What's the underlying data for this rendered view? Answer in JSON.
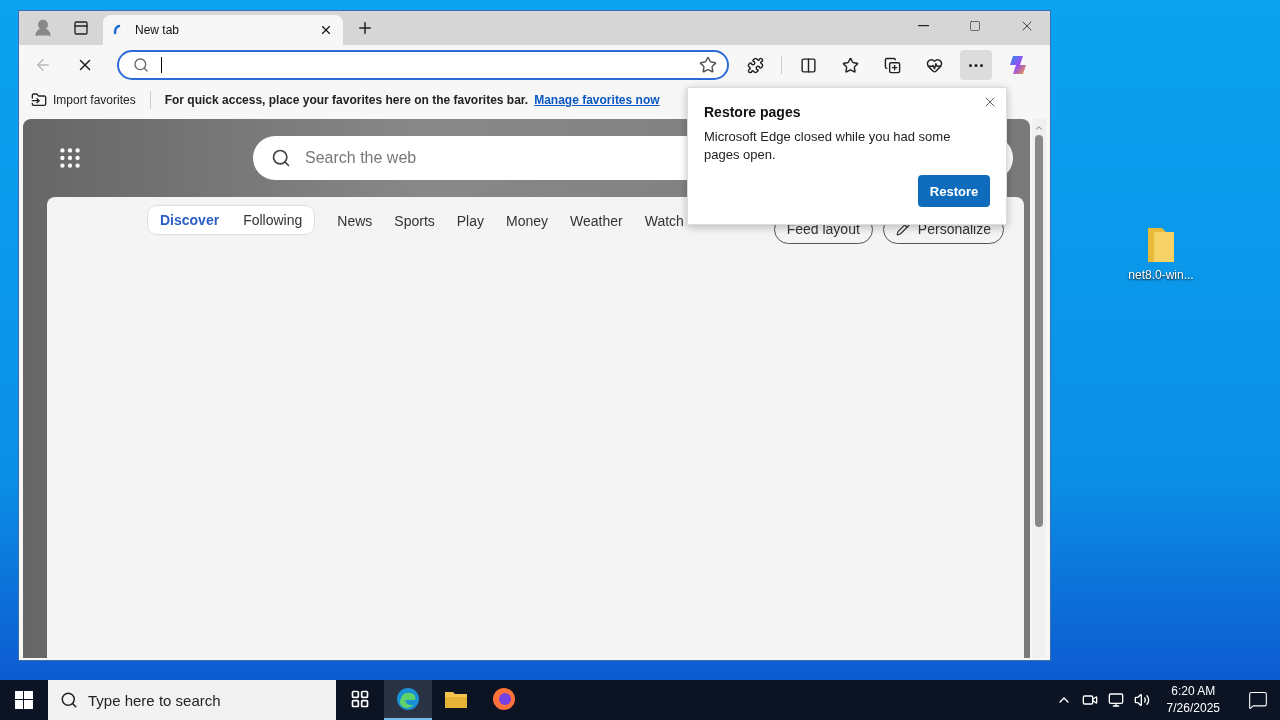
{
  "desktop": {
    "icons": [
      {
        "label": "net8.0-win..."
      }
    ]
  },
  "browser": {
    "tabs": [
      {
        "title": "New tab",
        "selected": true
      }
    ],
    "favorites_bar": {
      "import": "Import favorites",
      "message": "For quick access, place your favorites here on the favorites bar.",
      "link": "Manage favorites now"
    },
    "new_tab_page": {
      "search_placeholder": "Search the web",
      "feed_tabs": [
        {
          "label": "Discover",
          "selected": true
        },
        {
          "label": "Following",
          "selected": false
        }
      ],
      "nav": [
        "News",
        "Sports",
        "Play",
        "Money",
        "Weather",
        "Watch"
      ],
      "buttons": [
        {
          "kind": "layout",
          "label": "Feed layout"
        },
        {
          "kind": "personalize",
          "label": "Personalize"
        }
      ]
    },
    "restore_popup": {
      "title": "Restore pages",
      "message": "Microsoft Edge closed while you had some pages open.",
      "button": "Restore"
    }
  },
  "taskbar": {
    "search_placeholder": "Type here to search",
    "apps": [
      {
        "kind": "task-view",
        "selected": false
      },
      {
        "kind": "edge",
        "selected": true
      },
      {
        "kind": "explorer",
        "selected": false
      },
      {
        "kind": "firefox",
        "selected": false
      }
    ],
    "time": "6:20 AM",
    "date": "7/26/2025"
  }
}
